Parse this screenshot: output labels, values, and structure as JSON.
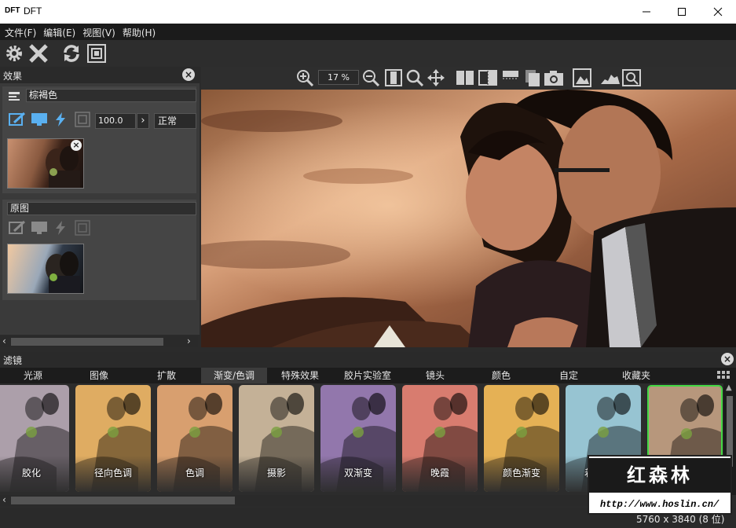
{
  "window": {
    "logo": "DFT",
    "title": "DFT"
  },
  "menu": [
    "文件(F)",
    "编辑(E)",
    "视图(V)",
    "帮助(H)"
  ],
  "effects": {
    "title": "效果",
    "layer1": {
      "name": "棕褐色",
      "opacity": "100.0",
      "blend": "正常"
    },
    "layer2": {
      "name": "原图"
    }
  },
  "view": {
    "zoom": "17 %"
  },
  "filters": {
    "title": "滤镜",
    "tabs": [
      "光源",
      "图像",
      "扩散",
      "渐变/色调",
      "特殊效果",
      "胶片实验室",
      "镜头",
      "颜色",
      "自定",
      "收藏夹"
    ],
    "active_tab": "渐变/色调",
    "items": [
      {
        "label": "胶化",
        "tint": "#9a8a98"
      },
      {
        "label": "径向色调",
        "tint": "#d89a40"
      },
      {
        "label": "色调",
        "tint": "#d08a50"
      },
      {
        "label": "摄影",
        "tint": "#b8a080"
      },
      {
        "label": "双渐变",
        "tint": "#7a5a9a"
      },
      {
        "label": "晚霞",
        "tint": "#d06050"
      },
      {
        "label": "颜色渐变",
        "tint": "#e0a030"
      },
      {
        "label": "着色渐变",
        "tint": "#80b8c8"
      },
      {
        "label": "棕褐色",
        "tint": "#a88060"
      }
    ]
  },
  "watermark": {
    "name": "红森林",
    "url": "http://www.hoslin.cn/"
  },
  "status": {
    "dimensions": "5760 x 3840 (8 位)"
  },
  "colors": {
    "selected_border": "#44d844",
    "menu_bg": "#1b1b1b"
  }
}
